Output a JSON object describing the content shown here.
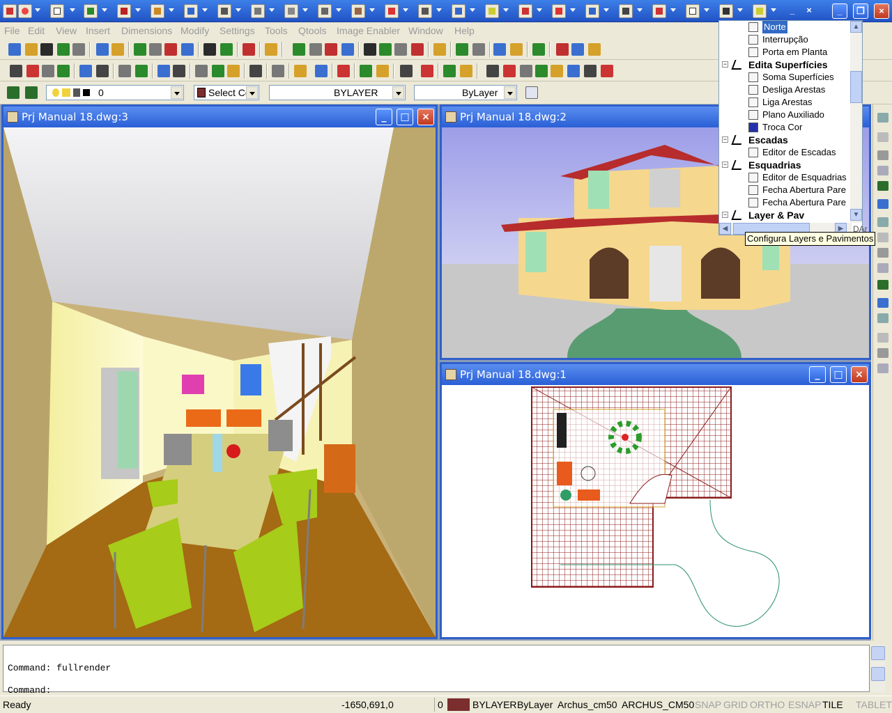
{
  "menubar": {
    "items": [
      "File",
      "Edit",
      "View",
      "Insert",
      "Dimensions",
      "Modify",
      "Settings",
      "Tools",
      "Qtools",
      "Image Enabler",
      "Window",
      "Help"
    ]
  },
  "layer_toolbar": {
    "layer_value": "0",
    "color_value": "Select Co",
    "linetype_value": "BYLAYER",
    "lineweight_value": "ByLayer"
  },
  "windows": {
    "w3": {
      "title": "Prj Manual 18.dwg:3"
    },
    "w2": {
      "title": "Prj Manual 18.dwg:2"
    },
    "w1": {
      "title": "Prj Manual 18.dwg:1"
    }
  },
  "tree": {
    "items": [
      {
        "label": "Norte",
        "type": "item",
        "selected": true
      },
      {
        "label": "Interrupção",
        "type": "item"
      },
      {
        "label": "Porta em Planta",
        "type": "item"
      },
      {
        "label": "Edita Superfícies",
        "type": "category"
      },
      {
        "label": "Soma Superfícies",
        "type": "item"
      },
      {
        "label": "Desliga Arestas",
        "type": "item"
      },
      {
        "label": "Liga Arestas",
        "type": "item"
      },
      {
        "label": "Plano Auxiliado",
        "type": "item"
      },
      {
        "label": "Troca Cor",
        "type": "item"
      },
      {
        "label": "Escadas",
        "type": "category"
      },
      {
        "label": "Editor de Escadas",
        "type": "item"
      },
      {
        "label": "Esquadrias",
        "type": "category"
      },
      {
        "label": "Editor de Esquadrias",
        "type": "item"
      },
      {
        "label": "Fecha Abertura Pare",
        "type": "item"
      },
      {
        "label": "Fecha Abertura Pare",
        "type": "item"
      },
      {
        "label": "Layer & Pav",
        "type": "category"
      }
    ],
    "h_overflow_text": "DAr"
  },
  "tooltip": {
    "text": "Configura Layers e Pavimentos"
  },
  "command": {
    "history_line": "Command: fullrender",
    "prompt": "Command:"
  },
  "status": {
    "ready": "Ready",
    "coords": "-1650,691,0",
    "layer_num": "0",
    "color": "BYLAYER",
    "linetype": "ByLayer",
    "style1": "Archus_cm50",
    "style2": "ARCHUS_CM50",
    "snap": "SNAP",
    "grid": "GRID",
    "ortho": "ORTHO",
    "esnap": "ESNAP",
    "tile": "TILE",
    "tablet": "TABLET"
  },
  "colors": {
    "titlebar": "#2a5fd6",
    "status_color_swatch": "#7a2e2e",
    "wire_red": "#8b1a1a"
  }
}
